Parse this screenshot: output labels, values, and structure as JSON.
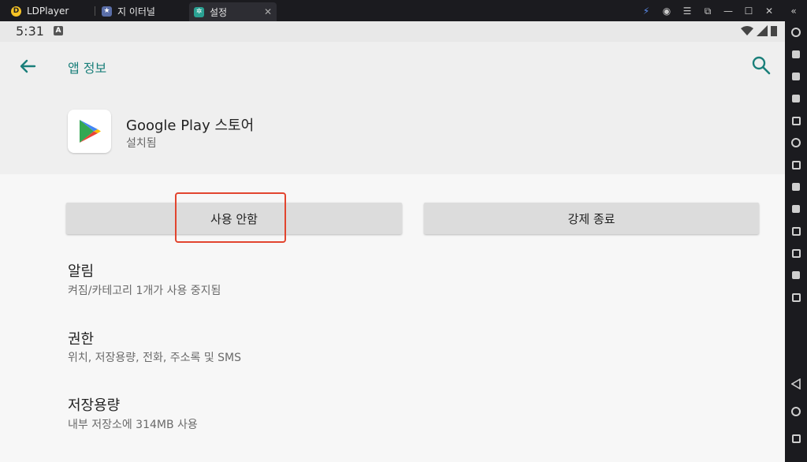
{
  "window": {
    "tabs": [
      {
        "label": "LDPlayer",
        "icon": "ldplayer-logo-icon"
      },
      {
        "label": "지 이터널",
        "icon": "game-icon"
      },
      {
        "label": "설정",
        "icon": "settings-gear-icon",
        "active": true
      }
    ],
    "controls": [
      "bolt-icon",
      "user-icon",
      "menu-icon",
      "restore-icon",
      "minimize-icon",
      "maximize-icon",
      "close-icon",
      "collapse-icon"
    ]
  },
  "statusbar": {
    "time": "5:31",
    "badge": "A"
  },
  "appbar": {
    "title": "앱 정보"
  },
  "app": {
    "name": "Google Play 스토어",
    "status": "설치됨"
  },
  "buttons": {
    "disable": "사용 안함",
    "force_stop": "강제 종료"
  },
  "items": [
    {
      "title": "알림",
      "subtitle": "켜짐/카테고리 1개가 사용 중지됨"
    },
    {
      "title": "권한",
      "subtitle": "위치, 저장용량, 전화, 주소록 및 SMS"
    },
    {
      "title": "저장용량",
      "subtitle": "내부 저장소에 314MB 사용"
    }
  ],
  "colors": {
    "accent": "#1a7f7a",
    "highlight": "#e2452f"
  }
}
